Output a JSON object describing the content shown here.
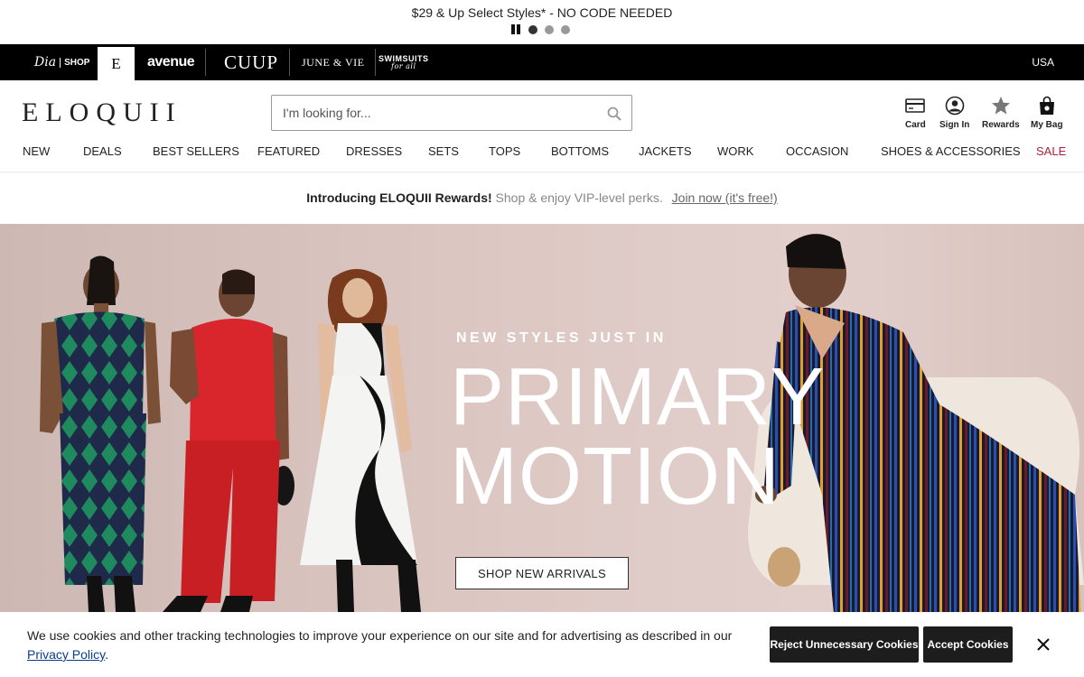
{
  "promo": {
    "text": "$29 & Up Select Styles* - NO CODE NEEDED",
    "slides": 3,
    "active_slide": 1
  },
  "brands": {
    "dia": "Dia",
    "dia_sub": "SHOP",
    "eloquii_short": "E",
    "avenue": "avenue",
    "cuup": "CUUP",
    "june": "JUNE & VIE",
    "swim": "SWIMSUITS",
    "swim_sub": "for all",
    "region": "USA"
  },
  "header": {
    "logo": "ELOQUII",
    "search_placeholder": "I'm looking for...",
    "utilities": {
      "card": "Card",
      "sign_in": "Sign In",
      "rewards": "Rewards",
      "bag": "My Bag"
    }
  },
  "nav": {
    "items": [
      "NEW",
      "DEALS",
      "BEST SELLERS",
      "FEATURED",
      "DRESSES",
      "SETS",
      "TOPS",
      "BOTTOMS",
      "JACKETS",
      "WORK",
      "OCCASION",
      "SHOES & ACCESSORIES",
      "SALE"
    ]
  },
  "rewards": {
    "headline": "Introducing ELOQUII Rewards!",
    "sub": "Shop & enjoy VIP-level perks.",
    "link": "Join now (it's free!)"
  },
  "hero": {
    "eyebrow": "NEW STYLES JUST IN",
    "title_line1": "PRIMARY",
    "title_line2": "MOTION",
    "cta": "SHOP NEW ARRIVALS"
  },
  "cookie": {
    "text": "We use cookies and other tracking technologies to improve your experience on our site and for advertising as described in our",
    "link": "Privacy Policy",
    "suffix": ".",
    "reject": "Reject Unnecessary Cookies",
    "accept": "Accept Cookies"
  },
  "colors": {
    "sale": "#b0203c",
    "brandbar": "#000000",
    "hero_bg": "#dcc7c3"
  }
}
